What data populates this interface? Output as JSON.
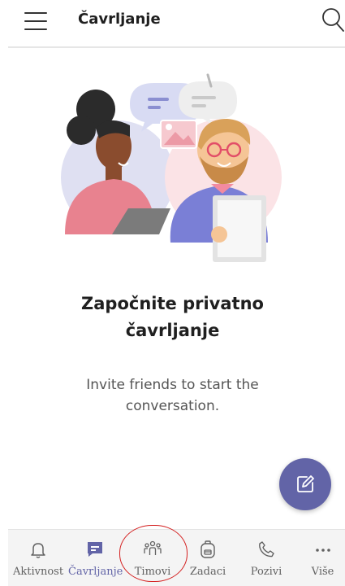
{
  "header": {
    "title": "Čavrljanje",
    "menu_icon": "hamburger-icon",
    "search_icon": "search-icon"
  },
  "empty_state": {
    "title_line1": "Započnite privatno",
    "title_line2": "čavrljanje",
    "subtitle_line1": "Invite friends to start the",
    "subtitle_line2": "conversation."
  },
  "fab": {
    "icon": "compose-icon"
  },
  "nav": {
    "items": [
      {
        "label": "Aktivnost",
        "icon": "bell-icon",
        "active": false
      },
      {
        "label": "Čavrljanje",
        "icon": "chat-icon",
        "active": true
      },
      {
        "label": "Timovi",
        "icon": "teams-icon",
        "active": false
      },
      {
        "label": "Zadaci",
        "icon": "backpack-icon",
        "active": false
      },
      {
        "label": "Pozivi",
        "icon": "phone-icon",
        "active": false
      },
      {
        "label": "Više",
        "icon": "more-icon",
        "active": false
      }
    ]
  },
  "colors": {
    "accent": "#6264a7",
    "annotation": "#d42020"
  }
}
